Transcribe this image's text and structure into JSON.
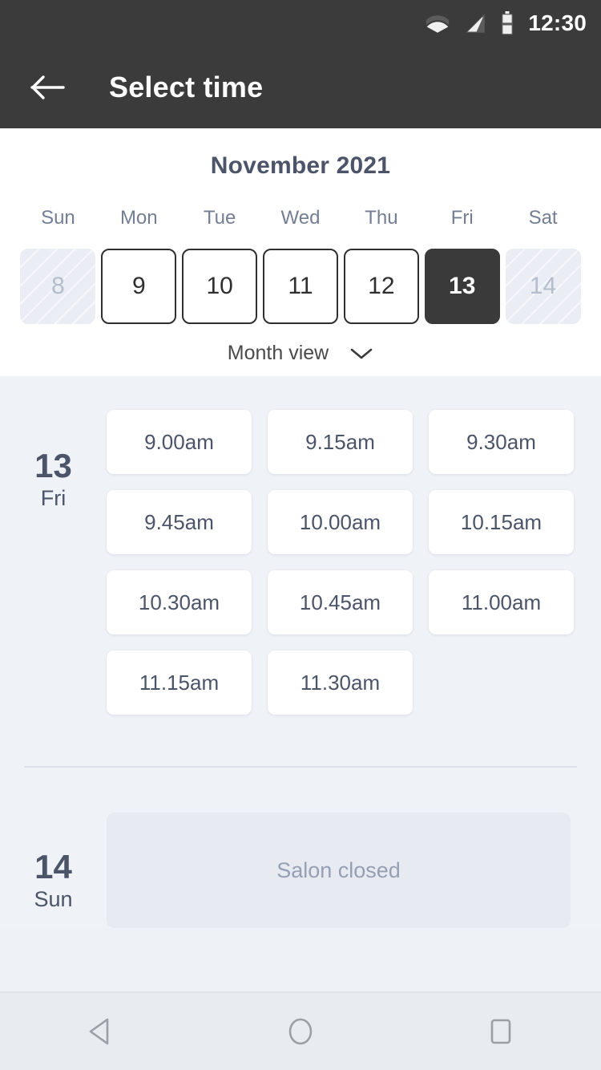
{
  "status_bar": {
    "clock": "12:30",
    "icons": [
      "wifi-icon",
      "signal-icon",
      "battery-icon"
    ]
  },
  "app_bar": {
    "back_icon": "arrow-left-icon",
    "title": "Select time"
  },
  "calendar": {
    "month_title": "November 2021",
    "day_of_week": [
      "Sun",
      "Mon",
      "Tue",
      "Wed",
      "Thu",
      "Fri",
      "Sat"
    ],
    "days": [
      {
        "label": "8",
        "state": "disabled"
      },
      {
        "label": "9",
        "state": "available"
      },
      {
        "label": "10",
        "state": "available"
      },
      {
        "label": "11",
        "state": "available"
      },
      {
        "label": "12",
        "state": "available"
      },
      {
        "label": "13",
        "state": "selected"
      },
      {
        "label": "14",
        "state": "disabled"
      }
    ],
    "view_toggle_label": "Month view",
    "view_toggle_icon": "chevron-down-icon",
    "selected_color": "#3a3a3a",
    "title_color": "#4b5468"
  },
  "schedule": {
    "days": [
      {
        "date_number": "13",
        "day_name": "Fri",
        "slots": [
          "9.00am",
          "9.15am",
          "9.30am",
          "9.45am",
          "10.00am",
          "10.15am",
          "10.30am",
          "10.45am",
          "11.00am",
          "11.15am",
          "11.30am"
        ]
      },
      {
        "date_number": "14",
        "day_name": "Sun",
        "closed_message": "Salon closed"
      }
    ]
  },
  "nav_bar": {
    "back_icon": "triangle-back-icon",
    "home_icon": "circle-home-icon",
    "recents_icon": "square-recents-icon"
  }
}
